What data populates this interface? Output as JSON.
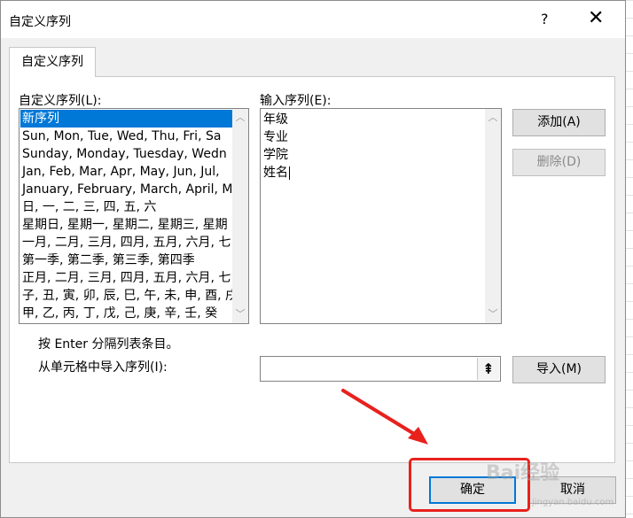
{
  "dialog": {
    "title": "自定义序列",
    "help_label": "?",
    "close_label": "✕"
  },
  "tab": {
    "label": "自定义序列"
  },
  "custom_lists": {
    "label": "自定义序列(L):",
    "items": [
      "新序列",
      "Sun, Mon, Tue, Wed, Thu, Fri, Sa",
      "Sunday, Monday, Tuesday, Wedn",
      "Jan, Feb, Mar, Apr, May, Jun, Jul,",
      "January, February, March, April, M",
      "日, 一, 二, 三, 四, 五, 六",
      "星期日, 星期一, 星期二, 星期三, 星期",
      "一月, 二月, 三月, 四月, 五月, 六月, 七",
      "第一季, 第二季, 第三季, 第四季",
      "正月, 二月, 三月, 四月, 五月, 六月, 七",
      "子, 丑, 寅, 卯, 辰, 巳, 午, 未, 申, 酉, 戌",
      "甲, 乙, 丙, 丁, 戊, 己, 庚, 辛, 壬, 癸"
    ],
    "selected_index": 0
  },
  "entries": {
    "label": "输入序列(E):",
    "lines": [
      "年级",
      "专业",
      "学院",
      "姓名"
    ]
  },
  "buttons": {
    "add": "添加(A)",
    "delete": "删除(D)",
    "import": "导入(M)",
    "ok": "确定",
    "cancel": "取消"
  },
  "hint": "按 Enter 分隔列表条目。",
  "import_label": "从单元格中导入序列(I):",
  "import_field_value": "",
  "range_icon": "⇞",
  "watermark": {
    "text": "Bai经验",
    "sub": "jingyan.baidu.com"
  },
  "colors": {
    "selection": "#0078d7",
    "annotation": "#e8211d"
  }
}
